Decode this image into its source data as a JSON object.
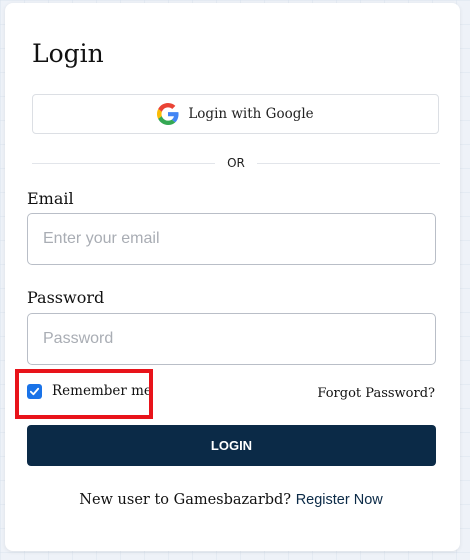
{
  "login": {
    "title": "Login",
    "google_button_label": "Login with Google",
    "divider_text": "OR",
    "email": {
      "label": "Email",
      "placeholder": "Enter your email",
      "value": ""
    },
    "password": {
      "label": "Password",
      "placeholder": "Password",
      "value": ""
    },
    "remember_me": {
      "label": "Remember me",
      "checked": true
    },
    "forgot_password_label": "Forgot Password?",
    "submit_label": "LOGIN",
    "footer": {
      "prompt": "New user to Gamesbazarbd?",
      "link_text": "Register Now"
    }
  },
  "icons": {
    "google": "google-g-logo",
    "check": "checkmark-icon"
  },
  "colors": {
    "primary": "#0b2a47",
    "checkbox": "#1a73e8",
    "highlight": "#e8131a"
  }
}
